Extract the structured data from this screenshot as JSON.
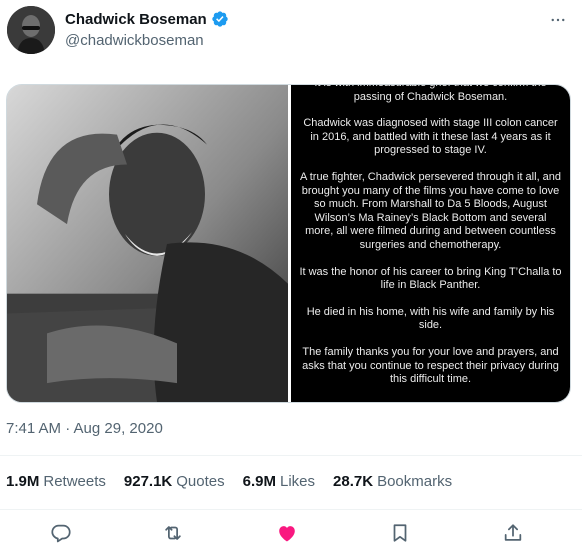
{
  "author": {
    "name": "Chadwick Boseman",
    "handle": "@chadwickboseman"
  },
  "media": {
    "statement_paragraphs": [
      "It is with immeasurable grief that we confirm the passing of Chadwick Boseman.",
      "Chadwick was diagnosed with stage III colon cancer in 2016, and battled with it these last 4 years as it progressed to stage IV.",
      "A true fighter, Chadwick persevered through it all, and brought you many of the films you have come to love so much. From Marshall to Da 5 Bloods, August Wilson’s Ma Rainey’s Black Bottom and several more, all were filmed during and between countless surgeries and chemotherapy.",
      "It was the honor of his career to bring King T’Challa to life in Black Panther.",
      "He died in his home, with his wife and family by his side.",
      "The family thanks you for your love and prayers, and asks that you continue to respect their privacy during this difficult time."
    ]
  },
  "timestamp": "7:41 AM · Aug 29, 2020",
  "stats": [
    {
      "count": "1.9M",
      "label": "Retweets"
    },
    {
      "count": "927.1K",
      "label": "Quotes"
    },
    {
      "count": "6.9M",
      "label": "Likes"
    },
    {
      "count": "28.7K",
      "label": "Bookmarks"
    }
  ],
  "icons": {
    "verified": "verified-badge-icon",
    "more": "more-options-icon",
    "reply": "reply-icon",
    "retweet": "retweet-icon",
    "like": "heart-icon",
    "bookmark": "bookmark-icon",
    "share": "share-icon"
  },
  "colors": {
    "verified": "#1d9bf0",
    "like": "#f91880",
    "secondary_text": "#536471"
  }
}
